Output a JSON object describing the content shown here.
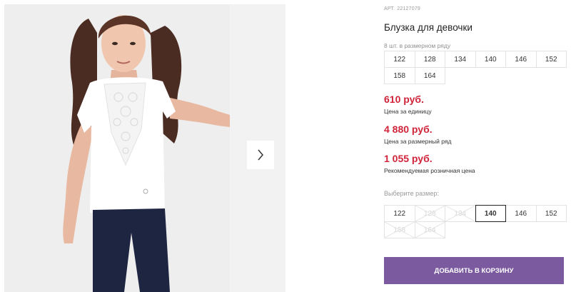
{
  "product": {
    "article_label": "АРТ.",
    "article_number": "22127079",
    "title": "Блузка для девочки",
    "image_alt": "Девочка в белой блузке с кружевной вставкой"
  },
  "pack": {
    "note": "8 шт. в размерном ряду",
    "sizes": [
      "122",
      "128",
      "134",
      "140",
      "146",
      "152",
      "158",
      "164"
    ]
  },
  "prices": {
    "unit_price": "610 руб.",
    "unit_label": "Цена за единицу",
    "pack_price": "4 880 руб.",
    "pack_label": "Цена за размерный ряд",
    "retail_price": "1 055 руб.",
    "retail_label": "Рекомендуемая розничная цена",
    "price_color": "#d0243b"
  },
  "size_select": {
    "label": "Выберите размер:",
    "options": [
      {
        "size": "122",
        "available": true,
        "selected": false
      },
      {
        "size": "128",
        "available": false,
        "selected": false
      },
      {
        "size": "134",
        "available": false,
        "selected": false
      },
      {
        "size": "140",
        "available": true,
        "selected": true
      },
      {
        "size": "146",
        "available": true,
        "selected": false
      },
      {
        "size": "152",
        "available": true,
        "selected": false
      },
      {
        "size": "158",
        "available": false,
        "selected": false
      },
      {
        "size": "164",
        "available": false,
        "selected": false
      }
    ]
  },
  "actions": {
    "add_to_cart": "ДОБАВИТЬ В КОРЗИНУ",
    "next_icon": "chevron-right-icon",
    "accent_color": "#7c5aa0"
  }
}
